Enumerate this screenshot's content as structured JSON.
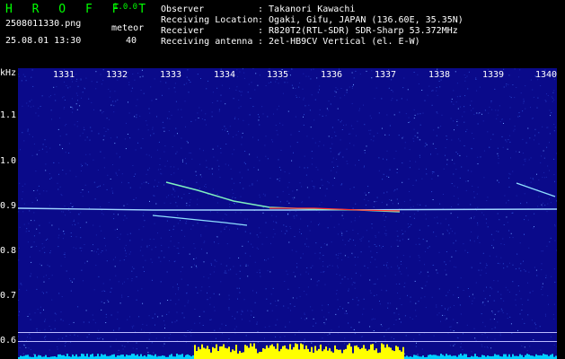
{
  "header": {
    "brand": "H R O F F T",
    "version": "1.0.0",
    "file_name": "2508011330.png",
    "datetime": "25.08.01 13:30",
    "meteor_label": "meteor",
    "meteor_count": "40",
    "info": [
      {
        "key": "Observer",
        "value": ": Takanori Kawachi"
      },
      {
        "key": "Receiving Location",
        "value": ": Ogaki, Gifu, JAPAN (136.60E, 35.35N)"
      },
      {
        "key": "Receiver",
        "value": ": R820T2(RTL-SDR) SDR-Sharp 53.372MHz"
      },
      {
        "key": "Receiving antenna",
        "value": ": 2el-HB9CV Vertical (el. E-W)"
      }
    ]
  },
  "axes": {
    "y_unit": "kHz",
    "x_ticks": [
      "1331",
      "1332",
      "1333",
      "1334",
      "1335",
      "1336",
      "1337",
      "1338",
      "1339",
      "1340"
    ],
    "y_ticks": [
      "1.1",
      "1.0",
      "0.9",
      "0.8",
      "0.7",
      "0.6"
    ]
  },
  "colors": {
    "background": "#0a0a8a",
    "brand": "#00ff00",
    "carrier": "#9fd4ff",
    "echo_hot": "#ff3030",
    "graph_fill": "#ffff00",
    "graph_base": "#00d0ff"
  }
}
